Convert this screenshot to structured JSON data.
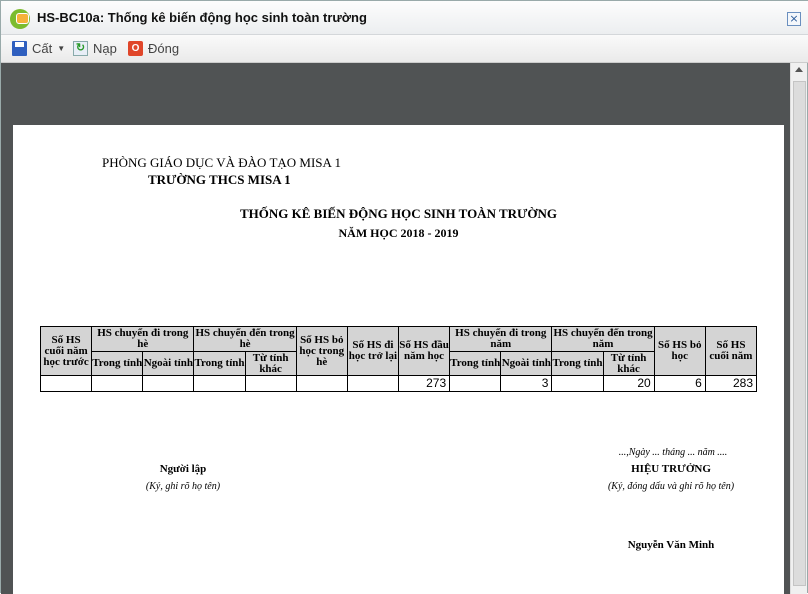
{
  "window": {
    "title": "HS-BC10a: Thống kê biến động học sinh toàn trường",
    "close": "×"
  },
  "toolbar": {
    "save": "Cất",
    "reload": "Nạp",
    "close": "Đóng"
  },
  "report": {
    "department": "PHÒNG GIÁO DỤC VÀ ĐÀO TẠO MISA 1",
    "school": "TRƯỜNG THCS MISA 1",
    "title": "THỐNG KÊ BIẾN ĐỘNG HỌC SINH TOÀN TRƯỜNG",
    "year": "NĂM HỌC 2018 - 2019",
    "headers": {
      "prev_end": "Số HS cuối năm học trước",
      "out_summer": "HS chuyển đi trong hè",
      "in_summer": "HS chuyển đến trong hè",
      "drop_summer": "Số HS bỏ học trong hè",
      "return": "Số HS đi học trở lại",
      "start": "Số HS đầu năm học",
      "out_year": "HS chuyển đi trong năm",
      "in_year": "HS chuyển đến trong năm",
      "drop": "Số HS bỏ học",
      "end": "Số HS cuối năm",
      "in_province": "Trong tỉnh",
      "out_province": "Ngoài tỉnh",
      "other_province": "Từ tỉnh khác"
    },
    "row": [
      "",
      "",
      "",
      "",
      "",
      "",
      "",
      "273",
      "",
      "3",
      "",
      "20",
      "6",
      "283"
    ],
    "date_line": "...,Ngày ... tháng ... năm ....",
    "preparer": "Người lập",
    "preparer_note": "(Ký, ghi rõ họ tên)",
    "principal": "HIỆU TRƯỞNG",
    "principal_note": "(Ký, đóng dấu và ghi rõ họ tên)",
    "principal_name": "Nguyễn Văn Minh"
  }
}
